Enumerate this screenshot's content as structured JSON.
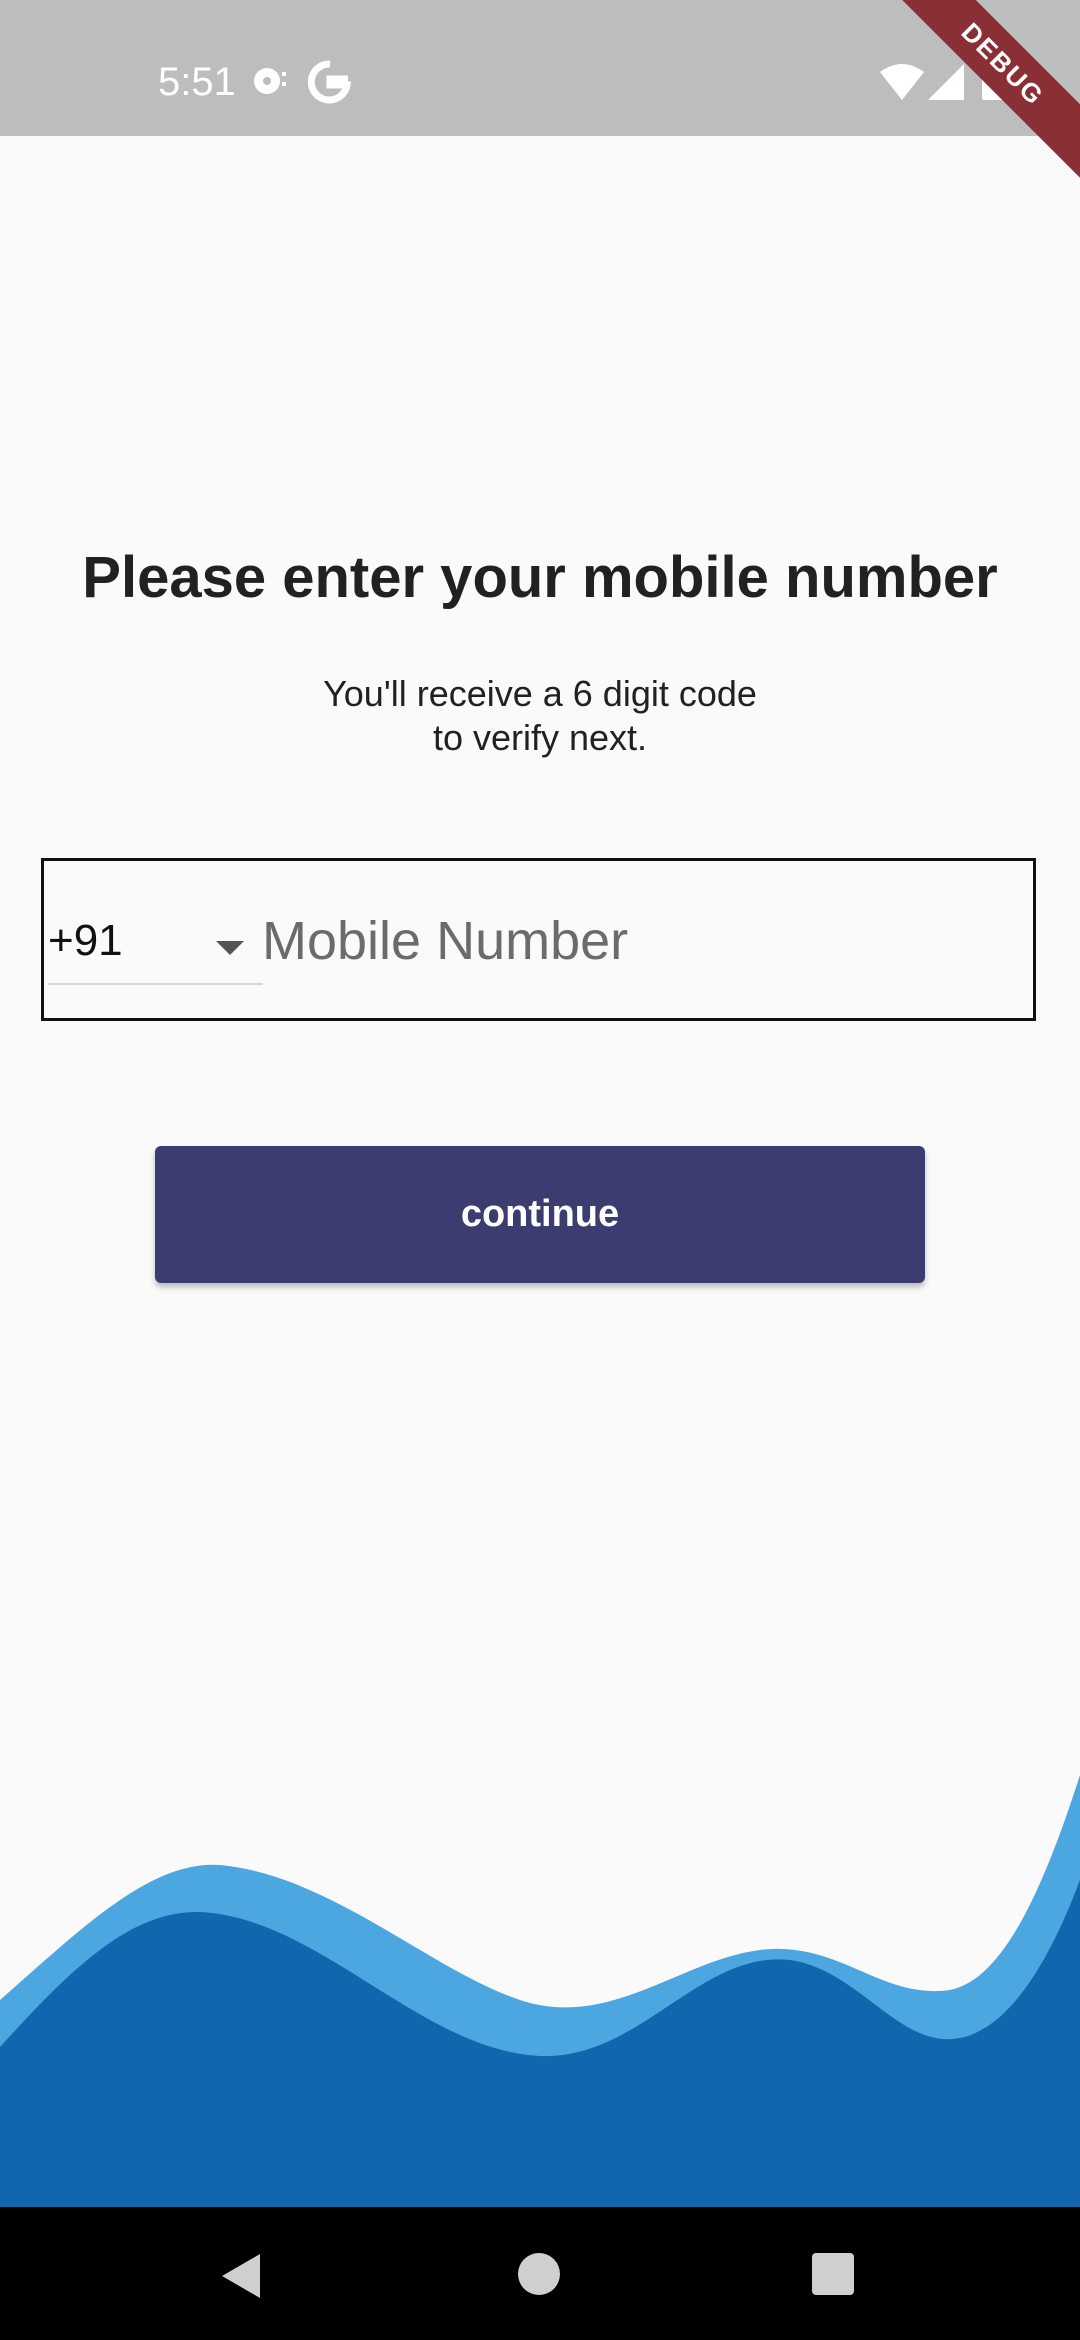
{
  "status_bar": {
    "time": "5:51",
    "debug_banner": "DEBUG",
    "icons": [
      "notification-icon",
      "google-icon",
      "wifi-icon",
      "signal-icon",
      "battery-icon"
    ]
  },
  "login": {
    "title": "Please enter your mobile number",
    "subtitle_line1": "You'll receive a 6 digit code",
    "subtitle_line2": "to verify next.",
    "country_code": "+91",
    "mobile_placeholder": "Mobile Number",
    "continue_label": "continue"
  },
  "colors": {
    "button": "#3b3d71",
    "wave_light": "#4ca6df",
    "wave_dark": "#1166ae",
    "status_bar": "#bdbdbd",
    "debug_ribbon": "#8b2f36"
  },
  "nav_bar": {
    "buttons": [
      "back-icon",
      "home-icon",
      "recents-icon"
    ]
  }
}
